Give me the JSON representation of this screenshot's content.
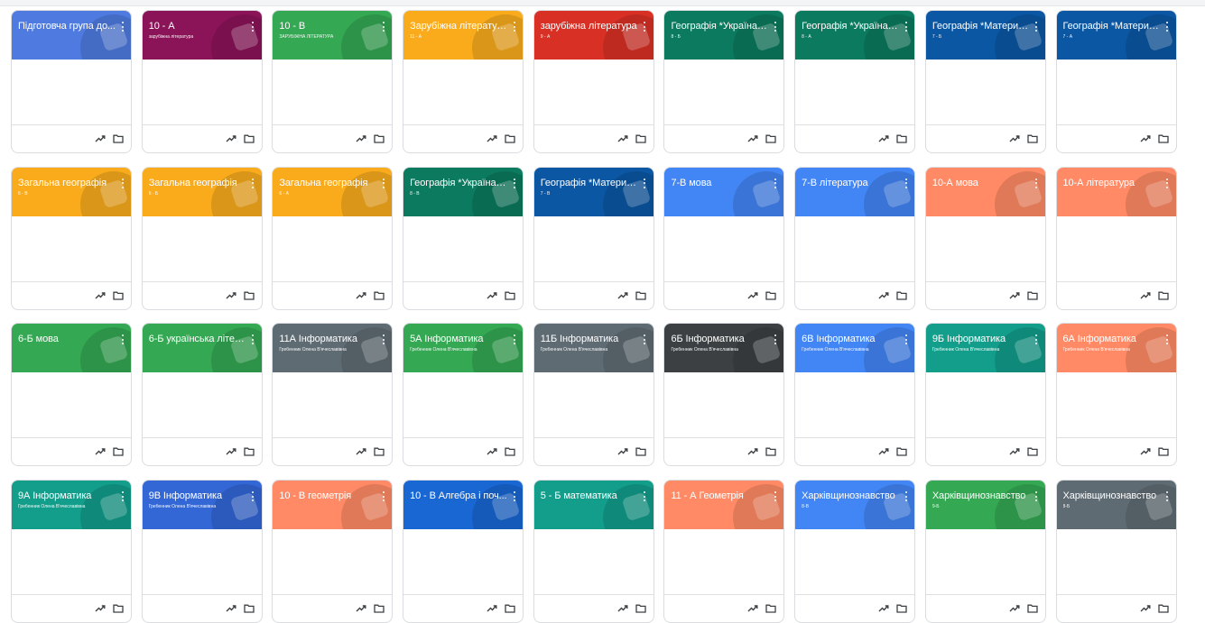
{
  "classes": [
    {
      "title": "Підготовча група до...",
      "subtitle": "",
      "color": "#4f7be0",
      "icon": "children-books-icon"
    },
    {
      "title": "10 - А",
      "subtitle": "зарубіжна література",
      "color": "#8b1459",
      "icon": "ticket-icon"
    },
    {
      "title": "10 - В",
      "subtitle": "ЗАРУБІЖНА ЛІТЕРАТУРА",
      "color": "#34a853",
      "icon": "book-icon"
    },
    {
      "title": "Зарубіжна література",
      "subtitle": "11 - А",
      "color": "#f9ab1c",
      "icon": "magnifier-icon"
    },
    {
      "title": "зарубіжна література",
      "subtitle": "9 - А",
      "color": "#d93025",
      "icon": "pen-icon"
    },
    {
      "title": "Географія *Україна у...",
      "subtitle": "8 - Б",
      "color": "#0b7a5e",
      "icon": "map-icon"
    },
    {
      "title": "Географія *Україна у...",
      "subtitle": "8 - А",
      "color": "#0b7a5e",
      "icon": "map-icon"
    },
    {
      "title": "Географія *Материк...",
      "subtitle": "7 - Б",
      "color": "#0b57a4",
      "icon": "globe-icon"
    },
    {
      "title": "Географія *Материк...",
      "subtitle": "7 - А",
      "color": "#0b57a4",
      "icon": "globe-icon"
    },
    {
      "title": "Загальна географія",
      "subtitle": "6 - В",
      "color": "#f9ab1c",
      "icon": "map-icon"
    },
    {
      "title": "Загальна географія",
      "subtitle": "6 - Б",
      "color": "#f9ab1c",
      "icon": "map-icon"
    },
    {
      "title": "Загальна географія",
      "subtitle": "6 - А",
      "color": "#f9ab1c",
      "icon": "map-icon"
    },
    {
      "title": "Географія *Україна у...",
      "subtitle": "8 - В",
      "color": "#0b7a5e",
      "icon": "map-icon"
    },
    {
      "title": "Географія *Материк...",
      "subtitle": "7 - В",
      "color": "#0b57a4",
      "icon": "globe-icon"
    },
    {
      "title": "7-В мова",
      "subtitle": "",
      "color": "#4285f4",
      "icon": "music-icon"
    },
    {
      "title": "7-В література",
      "subtitle": "",
      "color": "#4285f4",
      "icon": "music-icon"
    },
    {
      "title": "10-А мова",
      "subtitle": "",
      "color": "#ff8a65",
      "icon": "record-icon"
    },
    {
      "title": "10-А література",
      "subtitle": "",
      "color": "#ff8a65",
      "icon": "record-icon"
    },
    {
      "title": "6-Б мова",
      "subtitle": "",
      "color": "#34a853",
      "icon": "book-icon"
    },
    {
      "title": "6-Б українська літер...",
      "subtitle": "",
      "color": "#34a853",
      "icon": "book-icon"
    },
    {
      "title": "11А Інформатика",
      "subtitle": "Гребенник Олена В'ячеславівна",
      "color": "#5f6b73",
      "icon": "notebook-icon"
    },
    {
      "title": "5А Інформатика",
      "subtitle": "Гребенник Олена В'ячеславівна",
      "color": "#34a853",
      "icon": "book-icon"
    },
    {
      "title": "11Б Інформатика",
      "subtitle": "Гребенник Олена В'ячеславівна",
      "color": "#5f6b73",
      "icon": "tablet-icon"
    },
    {
      "title": "6Б Інформатика",
      "subtitle": "Гребенник Олена В'ячеславівна",
      "color": "#3c4043",
      "icon": "planet-icon"
    },
    {
      "title": "6В Інформатика",
      "subtitle": "Гребенник Олена В'ячеславівна",
      "color": "#4285f4",
      "icon": "music-icon"
    },
    {
      "title": "9Б Інформатика",
      "subtitle": "Гребенник Олена В'ячеславівна",
      "color": "#129e8b",
      "icon": "phone-icon"
    },
    {
      "title": "6А Інформатика",
      "subtitle": "Гребенник Олена В'ячеславівна",
      "color": "#ff8a65",
      "icon": "record-icon"
    },
    {
      "title": "9А Інформатика",
      "subtitle": "Гребенник Олена В'ячеславівна",
      "color": "#129e8b",
      "icon": "phone-icon"
    },
    {
      "title": "9В Інформатика",
      "subtitle": "Гребенник Олена В'ячеславівна",
      "color": "#3367d6",
      "icon": "headphones-icon"
    },
    {
      "title": "10 - В геометрія",
      "subtitle": "",
      "color": "#ff8a65",
      "icon": "record-icon"
    },
    {
      "title": "10 - В Алгебра і поч...",
      "subtitle": "",
      "color": "#1967d2",
      "icon": "pencil-icon"
    },
    {
      "title": "5 - Б математика",
      "subtitle": "",
      "color": "#129e8b",
      "icon": "phone-icon"
    },
    {
      "title": "11 - А Геометрія",
      "subtitle": "",
      "color": "#ff8a65",
      "icon": "record-icon"
    },
    {
      "title": "Харківщинознавство",
      "subtitle": "8-В",
      "color": "#4285f4",
      "icon": "music-icon"
    },
    {
      "title": "Харківщинознавство",
      "subtitle": "9-Б",
      "color": "#34a853",
      "icon": "book-icon"
    },
    {
      "title": "Харківщинознавство",
      "subtitle": "8-Б",
      "color": "#5f6b73",
      "icon": "tablet-icon"
    }
  ]
}
